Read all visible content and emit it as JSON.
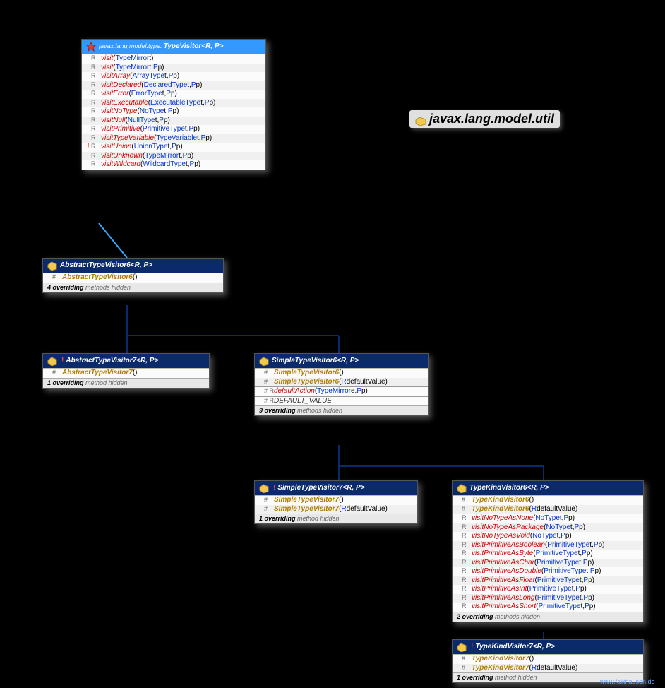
{
  "packageTitle": "javax.lang.model.util",
  "footer": "www.falkhausen.de",
  "typeVisitor": {
    "pkg": "javax.lang.model.type.",
    "name": "TypeVisitor",
    "generics": "<R, P>",
    "methods": [
      {
        "mod": "R",
        "bang": "",
        "name": "visit",
        "params": [
          [
            "TypeMirror",
            "t"
          ]
        ]
      },
      {
        "mod": "R",
        "bang": "",
        "name": "visit",
        "params": [
          [
            "TypeMirror",
            "t"
          ],
          [
            "P",
            "p"
          ]
        ]
      },
      {
        "mod": "R",
        "bang": "",
        "name": "visitArray",
        "params": [
          [
            "ArrayType",
            "t"
          ],
          [
            "P",
            "p"
          ]
        ]
      },
      {
        "mod": "R",
        "bang": "",
        "name": "visitDeclared",
        "params": [
          [
            "DeclaredType",
            "t"
          ],
          [
            "P",
            "p"
          ]
        ]
      },
      {
        "mod": "R",
        "bang": "",
        "name": "visitError",
        "params": [
          [
            "ErrorType",
            "t"
          ],
          [
            "P",
            "p"
          ]
        ]
      },
      {
        "mod": "R",
        "bang": "",
        "name": "visitExecutable",
        "params": [
          [
            "ExecutableType",
            "t"
          ],
          [
            "P",
            "p"
          ]
        ]
      },
      {
        "mod": "R",
        "bang": "",
        "name": "visitNoType",
        "params": [
          [
            "NoType",
            "t"
          ],
          [
            "P",
            "p"
          ]
        ]
      },
      {
        "mod": "R",
        "bang": "",
        "name": "visitNull",
        "params": [
          [
            "NullType",
            "t"
          ],
          [
            "P",
            "p"
          ]
        ]
      },
      {
        "mod": "R",
        "bang": "",
        "name": "visitPrimitive",
        "params": [
          [
            "PrimitiveType",
            "t"
          ],
          [
            "P",
            "p"
          ]
        ]
      },
      {
        "mod": "R",
        "bang": "",
        "name": "visitTypeVariable",
        "params": [
          [
            "TypeVariable",
            "t"
          ],
          [
            "P",
            "p"
          ]
        ]
      },
      {
        "mod": "R",
        "bang": "!",
        "name": "visitUnion",
        "params": [
          [
            "UnionType",
            "t"
          ],
          [
            "P",
            "p"
          ]
        ]
      },
      {
        "mod": "R",
        "bang": "",
        "name": "visitUnknown",
        "params": [
          [
            "TypeMirror",
            "t"
          ],
          [
            "P",
            "p"
          ]
        ]
      },
      {
        "mod": "R",
        "bang": "",
        "name": "visitWildcard",
        "params": [
          [
            "WildcardType",
            "t"
          ],
          [
            "P",
            "p"
          ]
        ]
      }
    ]
  },
  "abstract6": {
    "name": "AbstractTypeVisitor6",
    "generics": "<R, P>",
    "ctors": [
      {
        "mod": "#",
        "name": "AbstractTypeVisitor6",
        "params": []
      }
    ],
    "note": {
      "n": "4 overriding",
      "rest": " methods hidden"
    }
  },
  "abstract7": {
    "bang": "!",
    "name": "AbstractTypeVisitor7",
    "generics": "<R, P>",
    "ctors": [
      {
        "mod": "#",
        "name": "AbstractTypeVisitor7",
        "params": []
      }
    ],
    "note": {
      "n": "1 overriding",
      "rest": " method hidden"
    }
  },
  "simple6": {
    "name": "SimpleTypeVisitor6",
    "generics": "<R, P>",
    "ctors": [
      {
        "mod": "#",
        "name": "SimpleTypeVisitor6",
        "params": []
      },
      {
        "mod": "#",
        "name": "SimpleTypeVisitor6",
        "params": [
          [
            "R",
            "defaultValue"
          ]
        ]
      }
    ],
    "methods": [
      {
        "mod": "# R",
        "name": "defaultAction",
        "params": [
          [
            "TypeMirror",
            "e"
          ],
          [
            "P",
            "p"
          ]
        ]
      }
    ],
    "fields": [
      {
        "mod": "# R",
        "name": "DEFAULT_VALUE"
      }
    ],
    "note": {
      "n": "9 overriding",
      "rest": " methods hidden"
    }
  },
  "simple7": {
    "bang": "!",
    "name": "SimpleTypeVisitor7",
    "generics": "<R, P>",
    "ctors": [
      {
        "mod": "#",
        "name": "SimpleTypeVisitor7",
        "params": []
      },
      {
        "mod": "#",
        "name": "SimpleTypeVisitor7",
        "params": [
          [
            "R",
            "defaultValue"
          ]
        ]
      }
    ],
    "note": {
      "n": "1 overriding",
      "rest": " method hidden"
    }
  },
  "kind6": {
    "name": "TypeKindVisitor6",
    "generics": "<R, P>",
    "ctors": [
      {
        "mod": "#",
        "name": "TypeKindVisitor6",
        "params": []
      },
      {
        "mod": "#",
        "name": "TypeKindVisitor6",
        "params": [
          [
            "R",
            "defaultValue"
          ]
        ]
      }
    ],
    "methods": [
      {
        "mod": "R",
        "name": "visitNoTypeAsNone",
        "params": [
          [
            "NoType",
            "t"
          ],
          [
            "P",
            "p"
          ]
        ]
      },
      {
        "mod": "R",
        "name": "visitNoTypeAsPackage",
        "params": [
          [
            "NoType",
            "t"
          ],
          [
            "P",
            "p"
          ]
        ]
      },
      {
        "mod": "R",
        "name": "visitNoTypeAsVoid",
        "params": [
          [
            "NoType",
            "t"
          ],
          [
            "P",
            "p"
          ]
        ]
      },
      {
        "mod": "R",
        "name": "visitPrimitiveAsBoolean",
        "params": [
          [
            "PrimitiveType",
            "t"
          ],
          [
            "P",
            "p"
          ]
        ]
      },
      {
        "mod": "R",
        "name": "visitPrimitiveAsByte",
        "params": [
          [
            "PrimitiveType",
            "t"
          ],
          [
            "P",
            "p"
          ]
        ]
      },
      {
        "mod": "R",
        "name": "visitPrimitiveAsChar",
        "params": [
          [
            "PrimitiveType",
            "t"
          ],
          [
            "P",
            "p"
          ]
        ]
      },
      {
        "mod": "R",
        "name": "visitPrimitiveAsDouble",
        "params": [
          [
            "PrimitiveType",
            "t"
          ],
          [
            "P",
            "p"
          ]
        ]
      },
      {
        "mod": "R",
        "name": "visitPrimitiveAsFloat",
        "params": [
          [
            "PrimitiveType",
            "t"
          ],
          [
            "P",
            "p"
          ]
        ]
      },
      {
        "mod": "R",
        "name": "visitPrimitiveAsInt",
        "params": [
          [
            "PrimitiveType",
            "t"
          ],
          [
            "P",
            "p"
          ]
        ]
      },
      {
        "mod": "R",
        "name": "visitPrimitiveAsLong",
        "params": [
          [
            "PrimitiveType",
            "t"
          ],
          [
            "P",
            "p"
          ]
        ]
      },
      {
        "mod": "R",
        "name": "visitPrimitiveAsShort",
        "params": [
          [
            "PrimitiveType",
            "t"
          ],
          [
            "P",
            "p"
          ]
        ]
      }
    ],
    "note": {
      "n": "2 overriding",
      "rest": " methods hidden"
    }
  },
  "kind7": {
    "bang": "!",
    "name": "TypeKindVisitor7",
    "generics": "<R, P>",
    "ctors": [
      {
        "mod": "#",
        "name": "TypeKindVisitor7",
        "params": []
      },
      {
        "mod": "#",
        "name": "TypeKindVisitor7",
        "params": [
          [
            "R",
            "defaultValue"
          ]
        ]
      }
    ],
    "note": {
      "n": "1 overriding",
      "rest": " method hidden"
    }
  }
}
